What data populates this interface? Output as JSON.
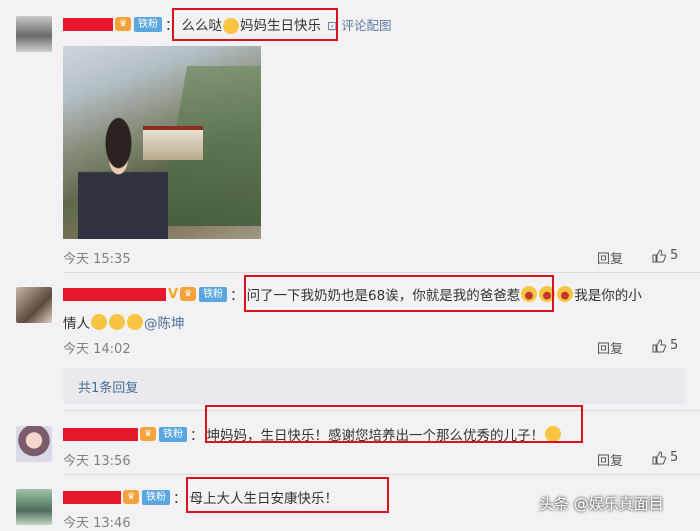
{
  "comments": [
    {
      "badge": "铁粉",
      "text_pre": "么么哒",
      "text_post": "妈妈生日快乐",
      "pic_link": "评论配图",
      "time": "今天 15:35",
      "reply_label": "回复",
      "like_count": "5"
    },
    {
      "badge": "铁粉",
      "text_line1": "问了一下我奶奶也是68诶，你就是我的爸爸惹",
      "text_line1_end": "我是你的小",
      "text_line2_pre": "情人",
      "mention": "@陈坤",
      "time": "今天 14:02",
      "reply_label": "回复",
      "like_count": "5",
      "sub_replies": "共1条回复"
    },
    {
      "badge": "铁粉",
      "text": "坤妈妈，生日快乐！感谢您培养出一个那么优秀的儿子！",
      "time": "今天 13:56",
      "reply_label": "回复",
      "like_count": "5"
    },
    {
      "badge": "铁粉",
      "text": "母上大人生日安康快乐！",
      "time": "今天 13:46"
    }
  ],
  "watermark": "头条 @娱乐真面目",
  "colors": {
    "highlight_box": "#d9121f",
    "name_redaction": "#e6162d",
    "fan_badge": "#5aa6e0"
  }
}
